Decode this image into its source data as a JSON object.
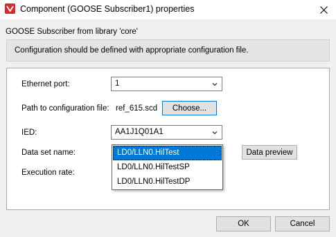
{
  "window": {
    "title": "Component (GOOSE Subscriber1) properties",
    "close_glyph": "✕"
  },
  "subtitle": "GOOSE Subscriber from library 'core'",
  "info": "Configuration should be defined with appropriate configuration file.",
  "form": {
    "ethernet_port": {
      "label": "Ethernet port:",
      "value": "1"
    },
    "path": {
      "label": "Path to configuration file:",
      "value": "ref_615.scd",
      "button": "Choose..."
    },
    "ied": {
      "label": "IED:",
      "value": "AA1J1Q01A1"
    },
    "dataset": {
      "label": "Data set name:",
      "options": [
        "LD0/LLN0.HilTest",
        "LD0/LLN0.HilTestSP",
        "LD0/LLN0.HilTestDP"
      ],
      "selected_index": 0
    },
    "data_preview_button": "Data preview",
    "execution_rate": {
      "label": "Execution rate:"
    }
  },
  "footer": {
    "ok": "OK",
    "cancel": "Cancel"
  },
  "colors": {
    "accent": "#0078d7",
    "app_icon": "#e0262b"
  },
  "icons": [
    "app-logo-icon",
    "close-icon",
    "chevron-down-icon"
  ]
}
